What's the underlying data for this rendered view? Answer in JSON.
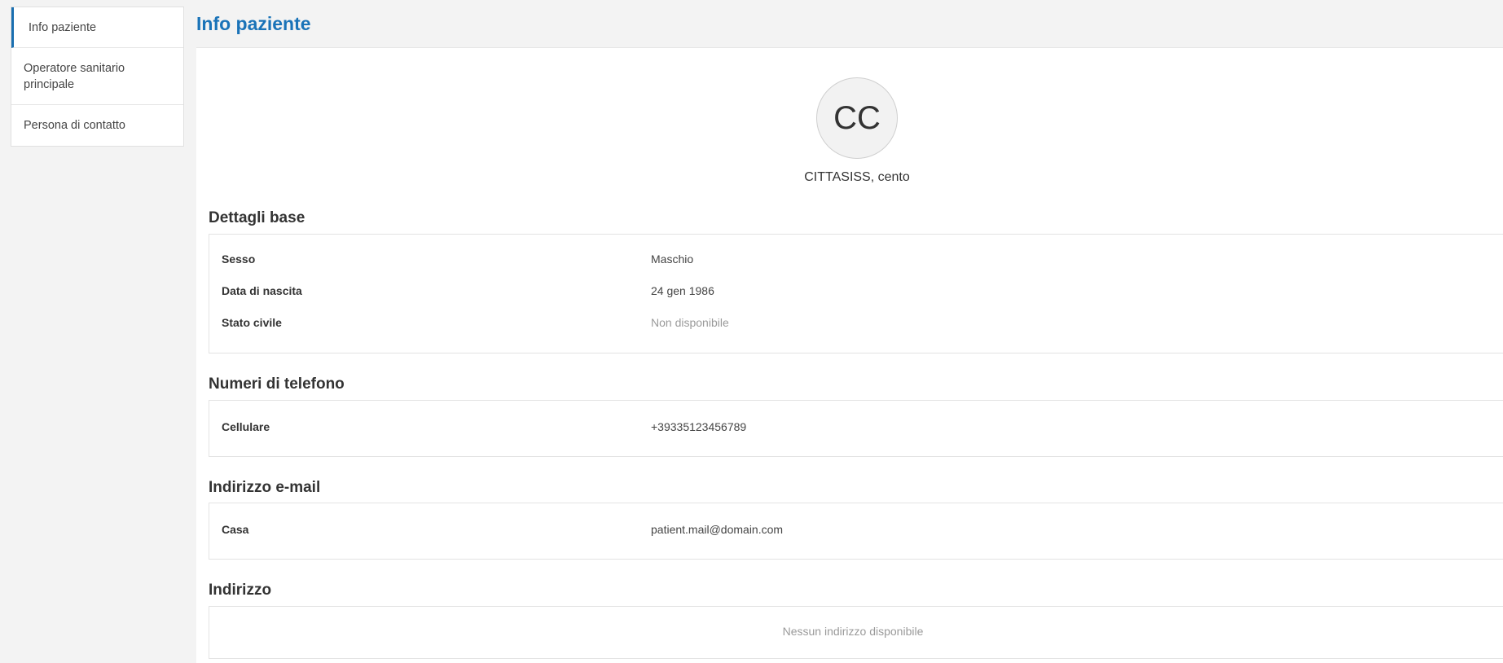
{
  "sidebar": {
    "items": [
      {
        "label": "Info paziente"
      },
      {
        "label": "Operatore sanitario principale"
      },
      {
        "label": "Persona di contatto"
      }
    ]
  },
  "header": {
    "title": "Info paziente"
  },
  "patient": {
    "initials": "CC",
    "name": "CITTASISS, cento"
  },
  "basic_details": {
    "title": "Dettagli base",
    "rows": [
      {
        "label": "Sesso",
        "value": "Maschio"
      },
      {
        "label": "Data di nascita",
        "value": "24 gen 1986"
      },
      {
        "label": "Stato civile",
        "value": "Non disponibile"
      }
    ]
  },
  "phones": {
    "title": "Numeri di telefono",
    "rows": [
      {
        "label": "Cellulare",
        "value": "+39335123456789"
      }
    ]
  },
  "emails": {
    "title": "Indirizzo e-mail",
    "rows": [
      {
        "label": "Casa",
        "value": "patient.mail@domain.com"
      }
    ]
  },
  "address": {
    "title": "Indirizzo",
    "empty": "Nessun indirizzo disponibile"
  },
  "colors": {
    "accent": "#1a73b8",
    "muted": "#9a9a9a"
  }
}
